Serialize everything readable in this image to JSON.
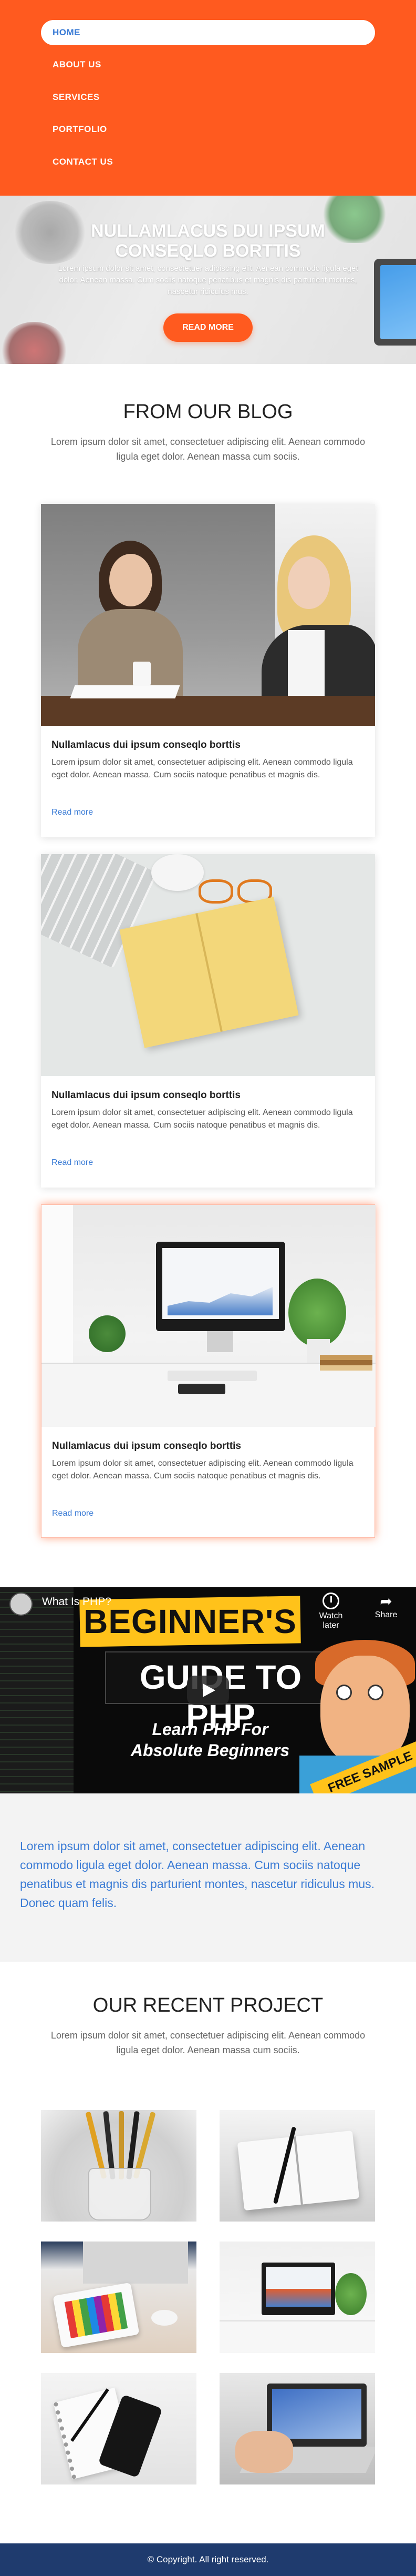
{
  "nav": {
    "items": [
      {
        "label": "HOME",
        "active": true
      },
      {
        "label": "ABOUT US",
        "active": false
      },
      {
        "label": "SERVICES",
        "active": false
      },
      {
        "label": "PORTFOLIO",
        "active": false
      },
      {
        "label": "CONTACT US",
        "active": false
      }
    ],
    "accent": "#ff5a1f"
  },
  "hero": {
    "title": "NULLAMLACUS DUI IPSUM CONSEQLO BORTTIS",
    "subtitle": "Lorem ipsum dolor sit amet, consectetuer adipiscing elit. Aenean commodo ligula eget dolor. Aenean massa. Cum sociis natoque penatibus et magnis dis parturient montes, nascetur ridiculus mus.",
    "button_label": "READ MORE"
  },
  "blog": {
    "title": "FROM OUR BLOG",
    "subtitle": "Lorem ipsum dolor sit amet, consectetuer adipiscing elit. Aenean commodo ligula eget dolor. Aenean massa cum sociis.",
    "cards": [
      {
        "title": "Nullamlacus dui ipsum conseqlo borttis",
        "text": "Lorem ipsum dolor sit amet, consectetuer adipiscing elit. Aenean commodo ligula eget dolor. Aenean massa. Cum sociis natoque penatibus et magnis dis.",
        "link": "Read more"
      },
      {
        "title": "Nullamlacus dui ipsum conseqlo borttis",
        "text": "Lorem ipsum dolor sit amet, consectetuer adipiscing elit. Aenean commodo ligula eget dolor. Aenean massa. Cum sociis natoque penatibus et magnis dis.",
        "link": "Read more"
      },
      {
        "title": "Nullamlacus dui ipsum conseqlo borttis",
        "text": "Lorem ipsum dolor sit amet, consectetuer adipiscing elit. Aenean commodo ligula eget dolor. Aenean massa. Cum sociis natoque penatibus et magnis dis.",
        "link": "Read more"
      }
    ]
  },
  "video": {
    "title": "What Is PHP?",
    "banner_line1": "BEGINNER'S",
    "banner_line2": "GUIDE TO PHP",
    "banner_line3": "Learn PHP For Absolute Beginners",
    "sample_label": "FREE SAMPLE",
    "watch_later": "Watch later",
    "share": "Share"
  },
  "quote": {
    "text": "Lorem ipsum dolor sit amet, consectetuer adipiscing elit. Aenean commodo ligula eget dolor. Aenean massa. Cum sociis natoque penatibus et magnis dis parturient montes, nascetur ridiculus mus. Donec quam felis."
  },
  "projects": {
    "title": "OUR RECENT PROJECT",
    "subtitle": "Lorem ipsum dolor sit amet, consectetuer adipiscing elit. Aenean commodo ligula eget dolor. Aenean massa cum sociis."
  },
  "footer": {
    "copyright": "© Copyright. All right reserved."
  }
}
